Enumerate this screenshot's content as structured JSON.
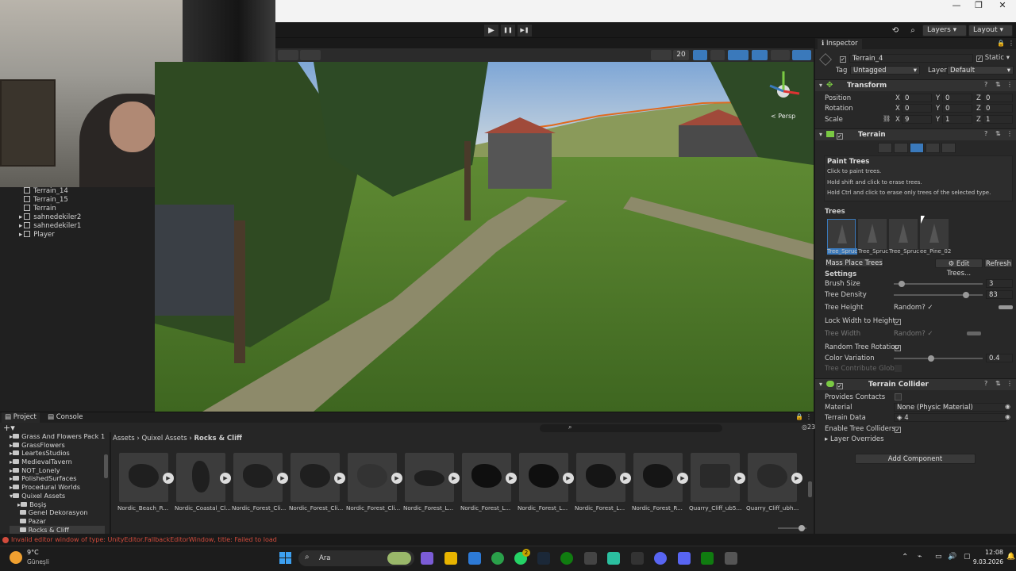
{
  "toolbar": {
    "layers_label": "Layers",
    "layout_label": "Layout",
    "play_icon": "▶",
    "pause_icon": "❚❚",
    "step_icon": "▶❚"
  },
  "scene": {
    "gizmo_label": "< Persp",
    "toolbar_count": "20"
  },
  "hierarchy": {
    "items": [
      {
        "label": "Terrain_14"
      },
      {
        "label": "Terrain_15"
      },
      {
        "label": "Terrain"
      },
      {
        "label": "sahnedekiler2"
      },
      {
        "label": "sahnedekiler1"
      },
      {
        "label": "Player"
      }
    ]
  },
  "project": {
    "tab_project": "Project",
    "tab_console": "Console",
    "breadcrumb": [
      "Assets",
      "Quixel Assets",
      "Rocks & Cliff"
    ],
    "count": "23",
    "folders": [
      {
        "label": "Grass And Flowers Pack 1"
      },
      {
        "label": "GrassFlowers"
      },
      {
        "label": "LeartesStudios"
      },
      {
        "label": "MedievalTavern"
      },
      {
        "label": "NOT_Lonely"
      },
      {
        "label": "PolishedSurfaces"
      },
      {
        "label": "Procedural Worlds"
      },
      {
        "label": "Quixel Assets"
      },
      {
        "label": "Boşiş"
      },
      {
        "label": "Genel Dekorasyon"
      },
      {
        "label": "Pazar"
      },
      {
        "label": "Rocks & Cliff"
      }
    ],
    "assets": [
      {
        "label": "Nordic_Beach_R..."
      },
      {
        "label": "Nordic_Coastal_Cl..."
      },
      {
        "label": "Nordic_Forest_Cli..."
      },
      {
        "label": "Nordic_Forest_Cli..."
      },
      {
        "label": "Nordic_Forest_Cli..."
      },
      {
        "label": "Nordic_Forest_L..."
      },
      {
        "label": "Nordic_Forest_L..."
      },
      {
        "label": "Nordic_Forest_L..."
      },
      {
        "label": "Nordic_Forest_L..."
      },
      {
        "label": "Nordic_Forest_R..."
      },
      {
        "label": "Quarry_Cliff_ub5..."
      },
      {
        "label": "Quarry_Cliff_ubh..."
      }
    ]
  },
  "status_message": "Invalid editor window of type: UnityEditor.FallbackEditorWindow, title: Failed to load",
  "inspector": {
    "tab_label": "Inspector",
    "object_name": "Terrain_4",
    "static_label": "Static",
    "tag_label": "Tag",
    "tag_value": "Untagged",
    "layer_label": "Layer",
    "layer_value": "Default",
    "transform": {
      "title": "Transform",
      "position_label": "Position",
      "rotation_label": "Rotation",
      "scale_label": "Scale",
      "x_label": "X",
      "y_label": "Y",
      "z_label": "Z",
      "position": [
        "0",
        "0",
        "0"
      ],
      "rotation": [
        "0",
        "0",
        "0"
      ],
      "scale": [
        "9",
        "1",
        "1"
      ]
    },
    "terrain": {
      "title": "Terrain",
      "paint_title": "Paint Trees",
      "paint_help1": "Click to paint trees.",
      "paint_help2": "Hold shift and click to erase trees.",
      "paint_help3": "Hold Ctrl and click to erase only trees of the selected type.",
      "trees_label": "Trees",
      "tree_names": [
        "Tree_Spruce",
        "Tree_Spruce",
        "Tree_Spruce",
        "ee_Pine_02"
      ],
      "mass_place": "Mass Place Trees",
      "edit_trees": "Edit Trees...",
      "refresh": "Refresh",
      "settings_label": "Settings",
      "brush_size_label": "Brush Size",
      "brush_size_value": "3",
      "tree_density_label": "Tree Density",
      "tree_density_value": "83",
      "tree_height_label": "Tree Height",
      "random_label": "Random?",
      "lock_width_label": "Lock Width to Height",
      "tree_width_label": "Tree Width",
      "random_rotation_label": "Random Tree Rotation",
      "color_variation_label": "Color Variation",
      "color_variation_value": "0.4",
      "contribute_global_label": "Tree Contribute Global"
    },
    "collider": {
      "title": "Terrain Collider",
      "provides_contacts_label": "Provides Contacts",
      "material_label": "Material",
      "material_value": "None (Physic Material)",
      "terrain_data_label": "Terrain Data",
      "terrain_data_value": "4",
      "enable_tree_colliders_label": "Enable Tree Colliders",
      "layer_overrides_label": "Layer Overrides"
    },
    "add_component": "Add Component"
  },
  "taskbar": {
    "weather_temp": "9°C",
    "weather_desc": "Güneşli",
    "search_label": "Ara",
    "badge_count": "2",
    "time": "12:08",
    "date": "9.03.2026"
  },
  "colors": {
    "accent": "#3a79bb",
    "error": "#d24b3c",
    "panel": "#282828"
  }
}
